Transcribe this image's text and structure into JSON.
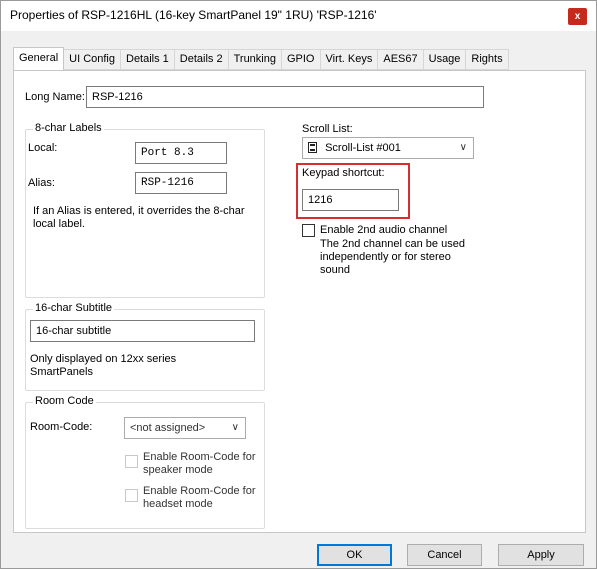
{
  "window": {
    "title": "Properties of RSP-1216HL (16-key SmartPanel 19\" 1RU) 'RSP-1216'",
    "close_label": "x"
  },
  "tabs": [
    {
      "label": "General",
      "active": true
    },
    {
      "label": "UI Config"
    },
    {
      "label": "Details 1"
    },
    {
      "label": "Details 2"
    },
    {
      "label": "Trunking"
    },
    {
      "label": "GPIO"
    },
    {
      "label": "Virt. Keys"
    },
    {
      "label": "AES67"
    },
    {
      "label": "Usage"
    },
    {
      "label": "Rights"
    }
  ],
  "general": {
    "long_name_label": "Long Name:",
    "long_name_value": "RSP-1216",
    "labels_group": {
      "title": "8-char Labels",
      "local_label": "Local:",
      "local_value": "Port 8.3",
      "alias_label": "Alias:",
      "alias_value": "RSP-1216",
      "note": "If an Alias is entered, it overrides the 8-char local label."
    },
    "subtitle_group": {
      "title": "16-char Subtitle",
      "value": "16-char subtitle",
      "note": "Only displayed on 12xx series SmartPanels"
    },
    "room_group": {
      "title": "Room Code",
      "room_code_label": "Room-Code:",
      "room_code_value": "<not assigned>",
      "speaker_label": "Enable Room-Code for speaker mode",
      "headset_label": "Enable Room-Code for headset mode"
    },
    "scroll_list": {
      "label": "Scroll List:",
      "value": "Scroll-List #001",
      "icon": "scroll-list-icon"
    },
    "keypad": {
      "label": "Keypad shortcut:",
      "value": "1216"
    },
    "audio": {
      "checkbox_label": "Enable 2nd audio channel",
      "note": "The 2nd channel can be used independently or for stereo sound"
    }
  },
  "buttons": {
    "ok": "OK",
    "cancel": "Cancel",
    "apply": "Apply"
  },
  "colors": {
    "highlight": "#d62f2f",
    "close": "#c42b1c",
    "default_button_border": "#0078d7"
  }
}
